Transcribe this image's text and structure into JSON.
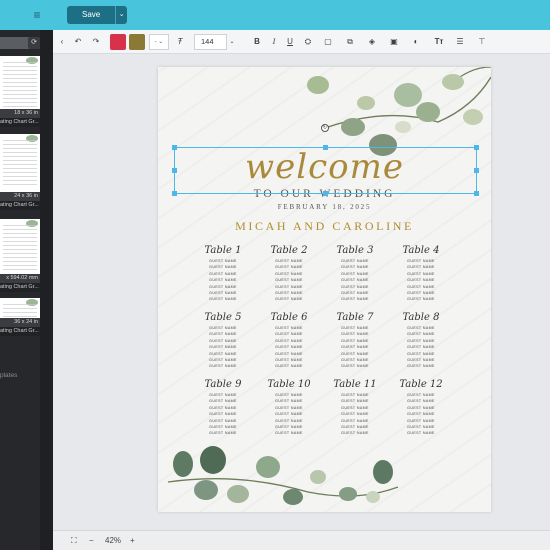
{
  "topbar": {
    "save_label": "Save",
    "save_caret": "⌄",
    "menu_icon": "≡"
  },
  "left_panel": {
    "thumbnails": [
      {
        "size": "18 x 36 in",
        "label": "ating Chart Gr..."
      },
      {
        "size": "24 x 36 in",
        "label": "ating Chart Gr..."
      },
      {
        "size": "x 594.02 mm",
        "label": "ating Chart Gr..."
      },
      {
        "size": "36 x 24 in",
        "label": "ating Chart Gr..."
      }
    ],
    "templates_label": "plates"
  },
  "toolbar": {
    "undo": "↶",
    "redo": "↷",
    "color1": "#d8324a",
    "color2": "#8a7a34",
    "font_dropdown": "- ⌄",
    "font_size": "144",
    "bold": "B",
    "italic": "I",
    "underline": "U",
    "text_icon": "Tт"
  },
  "document": {
    "welcome": "welcome",
    "to_our_wedding": "TO OUR WEDDING",
    "date": "FEBRUARY 18, 2025",
    "names": "MICAH AND CAROLINE",
    "guest_label": "GUEST NAME",
    "tables": [
      "Table 1",
      "Table 2",
      "Table 3",
      "Table 4",
      "Table 5",
      "Table 6",
      "Table 7",
      "Table 8",
      "Table 9",
      "Table 10",
      "Table 11",
      "Table 12"
    ]
  },
  "bottombar": {
    "zoom": "42%",
    "minus": "−",
    "plus": "+",
    "fit_icon": "⛶"
  }
}
